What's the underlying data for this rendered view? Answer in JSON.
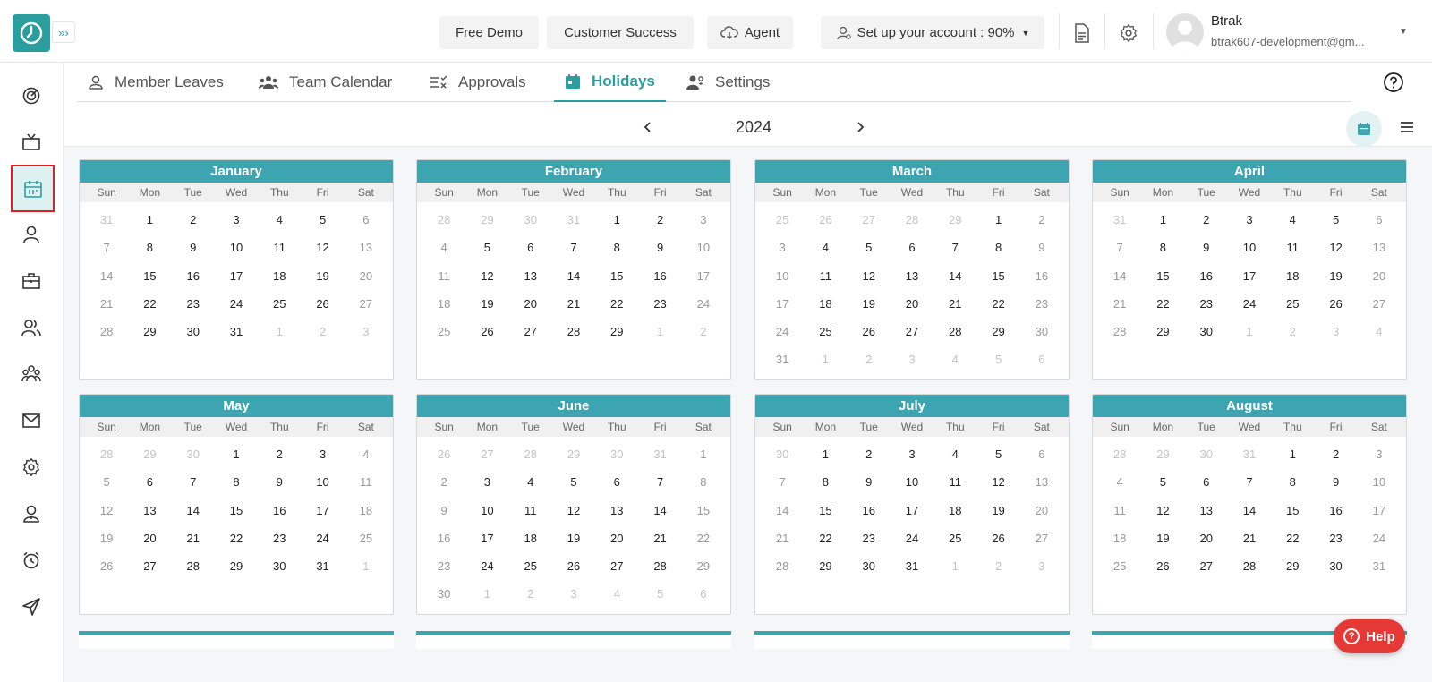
{
  "header": {
    "buttons": [
      {
        "label": "Free Demo"
      },
      {
        "label": "Customer Success"
      },
      {
        "label": "Agent"
      },
      {
        "label": "Set up your account : 90%"
      }
    ],
    "user": {
      "name": "Btrak",
      "email": "btrak607-development@gm..."
    }
  },
  "tabs": [
    {
      "label": "Member Leaves",
      "icon": "user-icon"
    },
    {
      "label": "Team Calendar",
      "icon": "team-icon"
    },
    {
      "label": "Approvals",
      "icon": "approvals-icon"
    },
    {
      "label": "Holidays",
      "icon": "calendar-icon",
      "active": true
    },
    {
      "label": "Settings",
      "icon": "user-settings-icon"
    }
  ],
  "year": "2024",
  "weekdays": [
    "Sun",
    "Mon",
    "Tue",
    "Wed",
    "Thu",
    "Fri",
    "Sat"
  ],
  "months": [
    {
      "name": "January",
      "first_weekday": 1,
      "days": 31,
      "prev_days": 31
    },
    {
      "name": "February",
      "first_weekday": 4,
      "days": 29,
      "prev_days": 31
    },
    {
      "name": "March",
      "first_weekday": 5,
      "days": 31,
      "prev_days": 29
    },
    {
      "name": "April",
      "first_weekday": 1,
      "days": 30,
      "prev_days": 31
    },
    {
      "name": "May",
      "first_weekday": 3,
      "days": 31,
      "prev_days": 30
    },
    {
      "name": "June",
      "first_weekday": 6,
      "days": 30,
      "prev_days": 31
    },
    {
      "name": "July",
      "first_weekday": 1,
      "days": 31,
      "prev_days": 30
    },
    {
      "name": "August",
      "first_weekday": 4,
      "days": 31,
      "prev_days": 31
    }
  ],
  "help_label": "Help",
  "accent_color": "#3ca5b1"
}
